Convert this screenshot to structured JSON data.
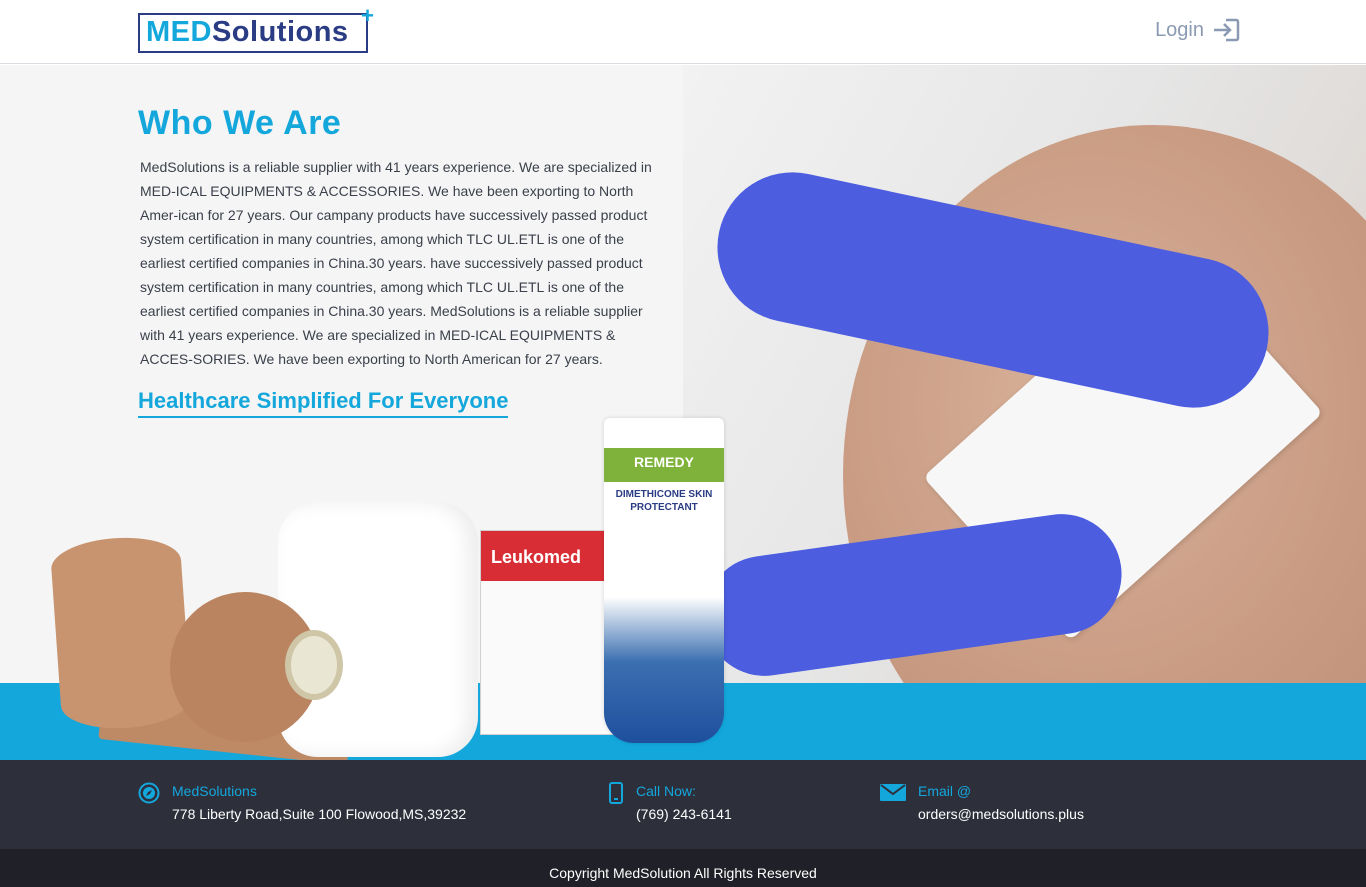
{
  "header": {
    "logo": {
      "part1": "MED",
      "part2": "Solutions",
      "plus": "+"
    },
    "login_label": "Login"
  },
  "hero": {
    "title": "Who We Are",
    "about": "MedSolutions is a reliable supplier with 41 years experience. We are specialized in MED-ICAL EQUIPMENTS & ACCESSORIES. We have been exporting to North Amer-ican for 27 years. Our campany products have successively passed product system certification in many countries, among which TLC UL.ETL is one of the earliest certified companies in China.30 years.  have successively passed product system certification in many countries, among which TLC UL.ETL is one of the earliest certified companies in China.30 years.  MedSolutions is a reliable supplier with 41 years experience. We are specialized in MED-ICAL EQUIPMENTS & ACCES-SORIES. We have been exporting to North American for 27 years.",
    "tagline": "Healthcare Simplified For Everyone",
    "product_box": "Leukomed",
    "product_tube_brand": "REMEDY",
    "product_tube_text": "DIMETHICONE SKIN PROTECTANT"
  },
  "footer": {
    "company": {
      "label": "MedSolutions",
      "value": "778 Liberty Road,Suite 100 Flowood,MS,39232",
      "icon": "compass-icon"
    },
    "phone": {
      "label": "Call Now:",
      "value": "(769) 243-6141",
      "icon": "phone-icon"
    },
    "email": {
      "label": "Email @",
      "value": "orders@medsolutions.plus",
      "icon": "mail-icon"
    },
    "copyright": "Copyright MedSolution All Rights Reserved"
  },
  "colors": {
    "accent": "#14a7dc",
    "brand_dark": "#2a3c84",
    "footer_bg": "#2d2f3b",
    "copyright_bg": "#202128"
  }
}
